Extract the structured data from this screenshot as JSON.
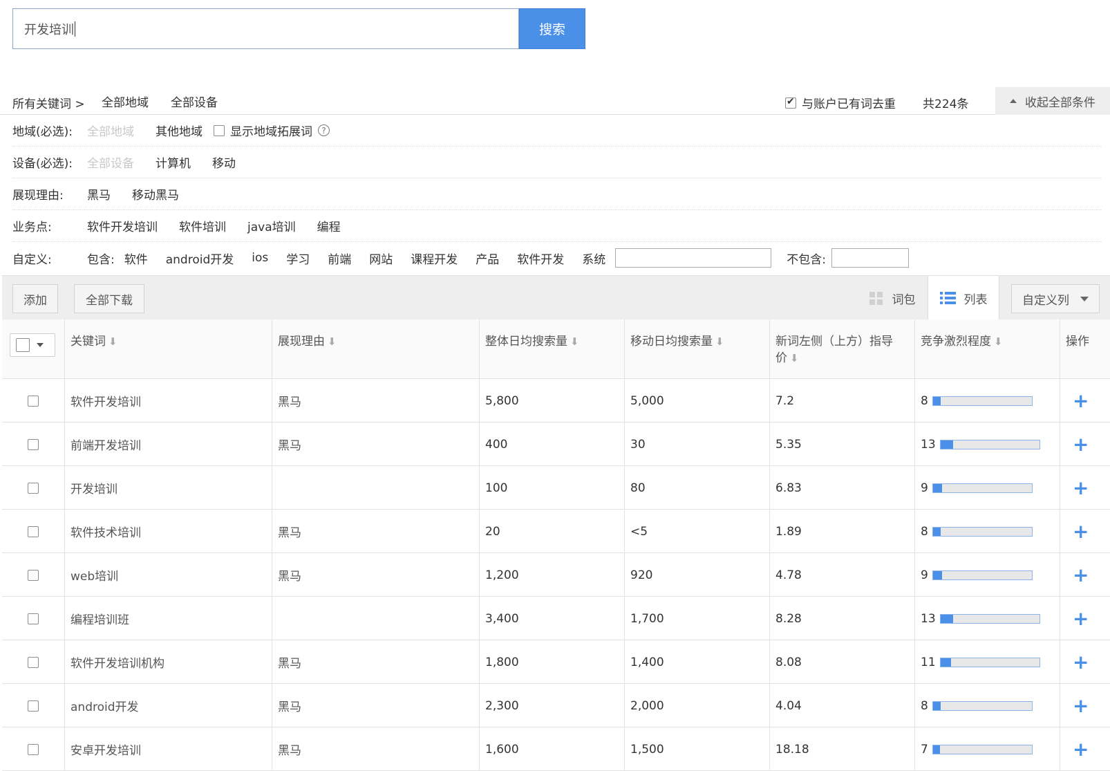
{
  "search": {
    "value": "开发培训",
    "button": "搜索"
  },
  "breadcrumb": {
    "root": "所有关键词 >",
    "region": "全部地域",
    "device": "全部设备"
  },
  "dedupe": {
    "label": "与账户已有词去重",
    "checked": true
  },
  "total": "共224条",
  "collapse": "收起全部条件",
  "filters": {
    "region": {
      "label": "地域(必选):",
      "options": [
        "全部地域",
        "其他地域"
      ],
      "expand_label": "显示地域拓展词",
      "help": "?"
    },
    "device": {
      "label": "设备(必选):",
      "options": [
        "全部设备",
        "计算机",
        "移动"
      ]
    },
    "reason": {
      "label": "展现理由:",
      "options": [
        "黑马",
        "移动黑马"
      ]
    },
    "business": {
      "label": "业务点:",
      "options": [
        "软件开发培训",
        "软件培训",
        "java培训",
        "编程"
      ]
    },
    "custom": {
      "label": "自定义:",
      "include_label": "包含:",
      "options": [
        "软件",
        "android开发",
        "ios",
        "学习",
        "前端",
        "网站",
        "课程开发",
        "产品",
        "软件开发",
        "系统"
      ],
      "exclude_label": "不包含:"
    }
  },
  "toolbar": {
    "add": "添加",
    "download_all": "全部下载",
    "view_package": "词包",
    "view_list": "列表",
    "custom_columns": "自定义列"
  },
  "table": {
    "headers": {
      "keyword": "关键词",
      "reason": "展现理由",
      "daily_total": "整体日均搜索量",
      "daily_mobile": "移动日均搜索量",
      "bid_line1": "新词左侧（上方）指导",
      "bid_line2": "价",
      "competition": "竞争激烈程度",
      "action": "操作"
    },
    "rows": [
      {
        "keyword": "软件开发培训",
        "reason": "黑马",
        "daily_total": "5,800",
        "daily_mobile": "5,000",
        "bid": "7.2",
        "competition": 8
      },
      {
        "keyword": "前端开发培训",
        "reason": "黑马",
        "daily_total": "400",
        "daily_mobile": "30",
        "bid": "5.35",
        "competition": 13
      },
      {
        "keyword": "开发培训",
        "reason": "",
        "daily_total": "100",
        "daily_mobile": "80",
        "bid": "6.83",
        "competition": 9
      },
      {
        "keyword": "软件技术培训",
        "reason": "黑马",
        "daily_total": "20",
        "daily_mobile": "<5",
        "bid": "1.89",
        "competition": 8
      },
      {
        "keyword": "web培训",
        "reason": "黑马",
        "daily_total": "1,200",
        "daily_mobile": "920",
        "bid": "4.78",
        "competition": 9
      },
      {
        "keyword": "编程培训班",
        "reason": "",
        "daily_total": "3,400",
        "daily_mobile": "1,700",
        "bid": "8.28",
        "competition": 13
      },
      {
        "keyword": "软件开发培训机构",
        "reason": "黑马",
        "daily_total": "1,800",
        "daily_mobile": "1,400",
        "bid": "8.08",
        "competition": 11
      },
      {
        "keyword": "android开发",
        "reason": "黑马",
        "daily_total": "2,300",
        "daily_mobile": "2,000",
        "bid": "4.04",
        "competition": 8
      },
      {
        "keyword": "安卓开发培训",
        "reason": "黑马",
        "daily_total": "1,600",
        "daily_mobile": "1,500",
        "bid": "18.18",
        "competition": 7
      }
    ],
    "action_symbol": "+",
    "sort_symbol": "⬇"
  },
  "colors": {
    "accent": "#4a90e8",
    "border": "#e2e2e2",
    "toolbar_bg": "#eeeeee"
  }
}
